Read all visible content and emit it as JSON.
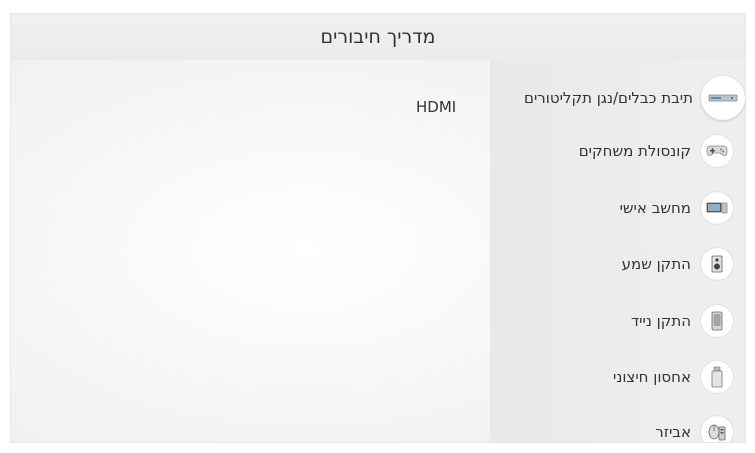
{
  "header": {
    "title": "מדריך חיבורים"
  },
  "sidebar": {
    "items": [
      {
        "label": "תיבת כבלים/נגן תקליטורים",
        "icon": "set-top-box-icon",
        "selected": true
      },
      {
        "label": "קונסולת משחקים",
        "icon": "game-controller-icon"
      },
      {
        "label": "מחשב אישי",
        "icon": "pc-icon"
      },
      {
        "label": "התקן שמע",
        "icon": "speaker-icon"
      },
      {
        "label": "התקן נייד",
        "icon": "mobile-device-icon"
      },
      {
        "label": "אחסון חיצוני",
        "icon": "usb-storage-icon"
      },
      {
        "label": "אביזר",
        "icon": "accessory-icon"
      }
    ]
  },
  "detail": {
    "items": [
      "HDMI"
    ]
  },
  "colors": {
    "sidebar_bg": "#ececec",
    "panel_bg": "#f4f4f4",
    "accent": "#4a90c8"
  }
}
